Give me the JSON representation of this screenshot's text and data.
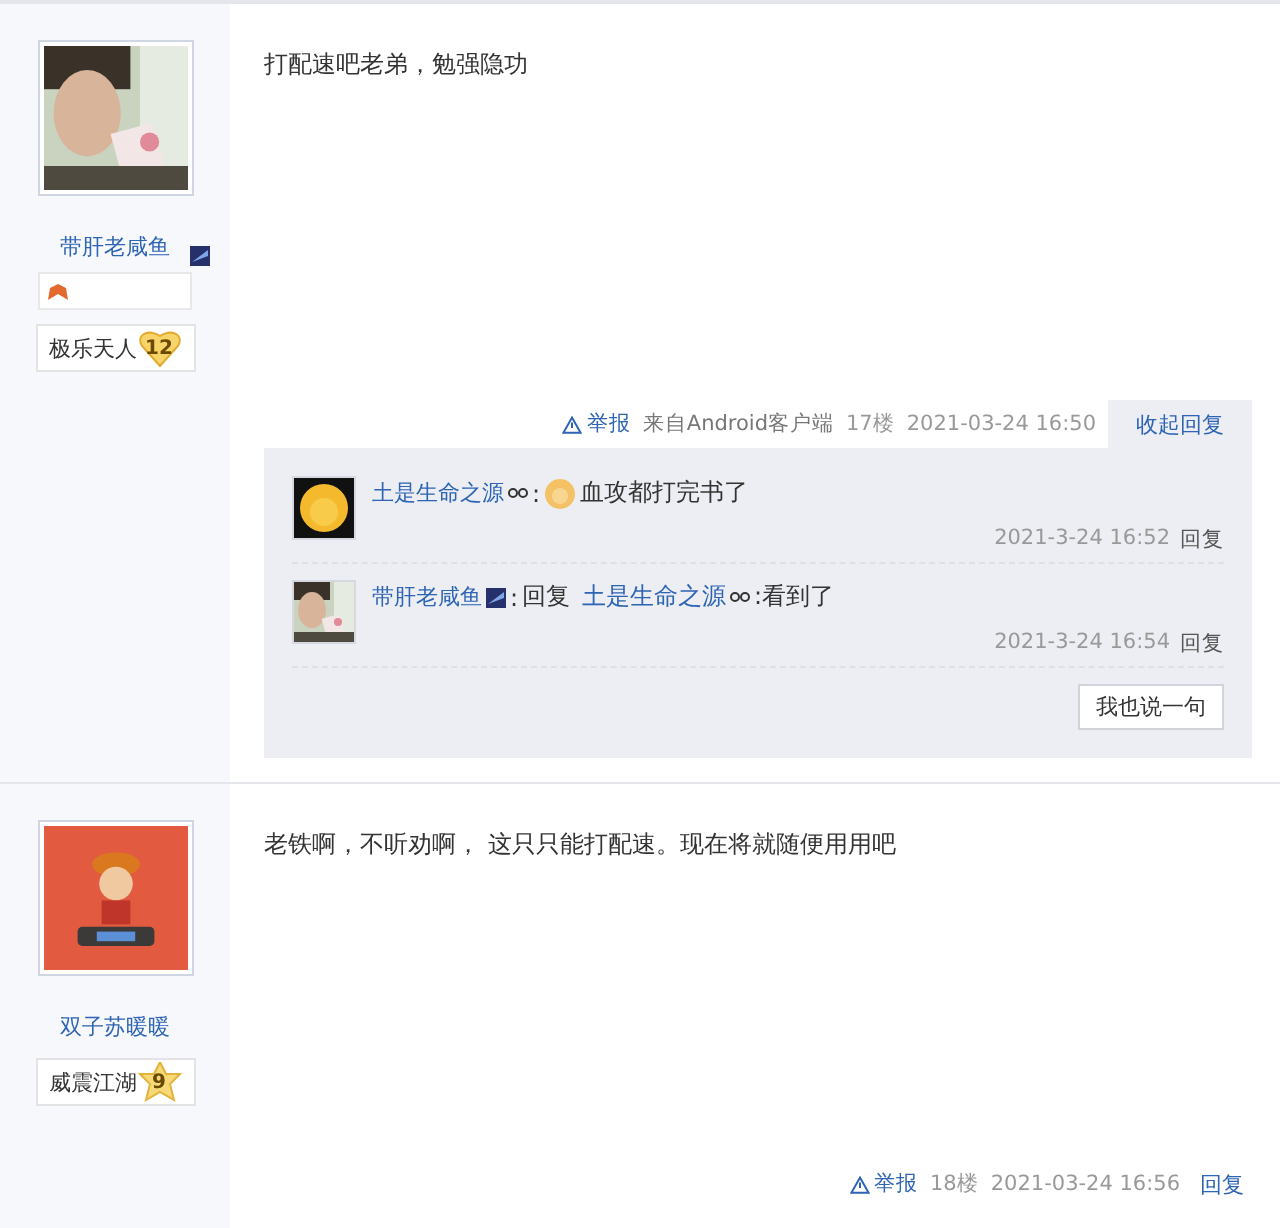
{
  "posts": [
    {
      "author": "带肝老咸鱼",
      "vip": true,
      "medal": true,
      "rank": {
        "title": "极乐天人",
        "level": "12",
        "kind": "heart"
      },
      "content": "打配速吧老弟，勉强隐功",
      "footer": {
        "report": "举报",
        "source": "来自Android客户端",
        "floor": "17楼",
        "time": "2021-03-24 16:50",
        "action": "收起回复",
        "expanded": true
      },
      "replies": [
        {
          "author": "土是生命之源",
          "zodiac": true,
          "colon": ":",
          "emoji": true,
          "text": "血攻都打完书了",
          "time": "2021-3-24 16:52",
          "action": "回复"
        },
        {
          "author": "带肝老咸鱼",
          "vip": true,
          "colon": ":",
          "reply_word": "回复",
          "target": "土是生命之源",
          "target_zodiac": true,
          "text": ":看到了",
          "time": "2021-3-24 16:54",
          "action": "回复"
        }
      ],
      "reply_button": "我也说一句"
    },
    {
      "author": "双子苏暖暖",
      "vip": false,
      "medal": false,
      "rank": {
        "title": "威震江湖",
        "level": "9",
        "kind": "star"
      },
      "content": "老铁啊，不听劝啊， 这只只能打配速。现在将就随便用用吧",
      "footer": {
        "report": "举报",
        "floor": "18楼",
        "time": "2021-03-24 16:56",
        "action": "回复",
        "expanded": false
      }
    }
  ]
}
